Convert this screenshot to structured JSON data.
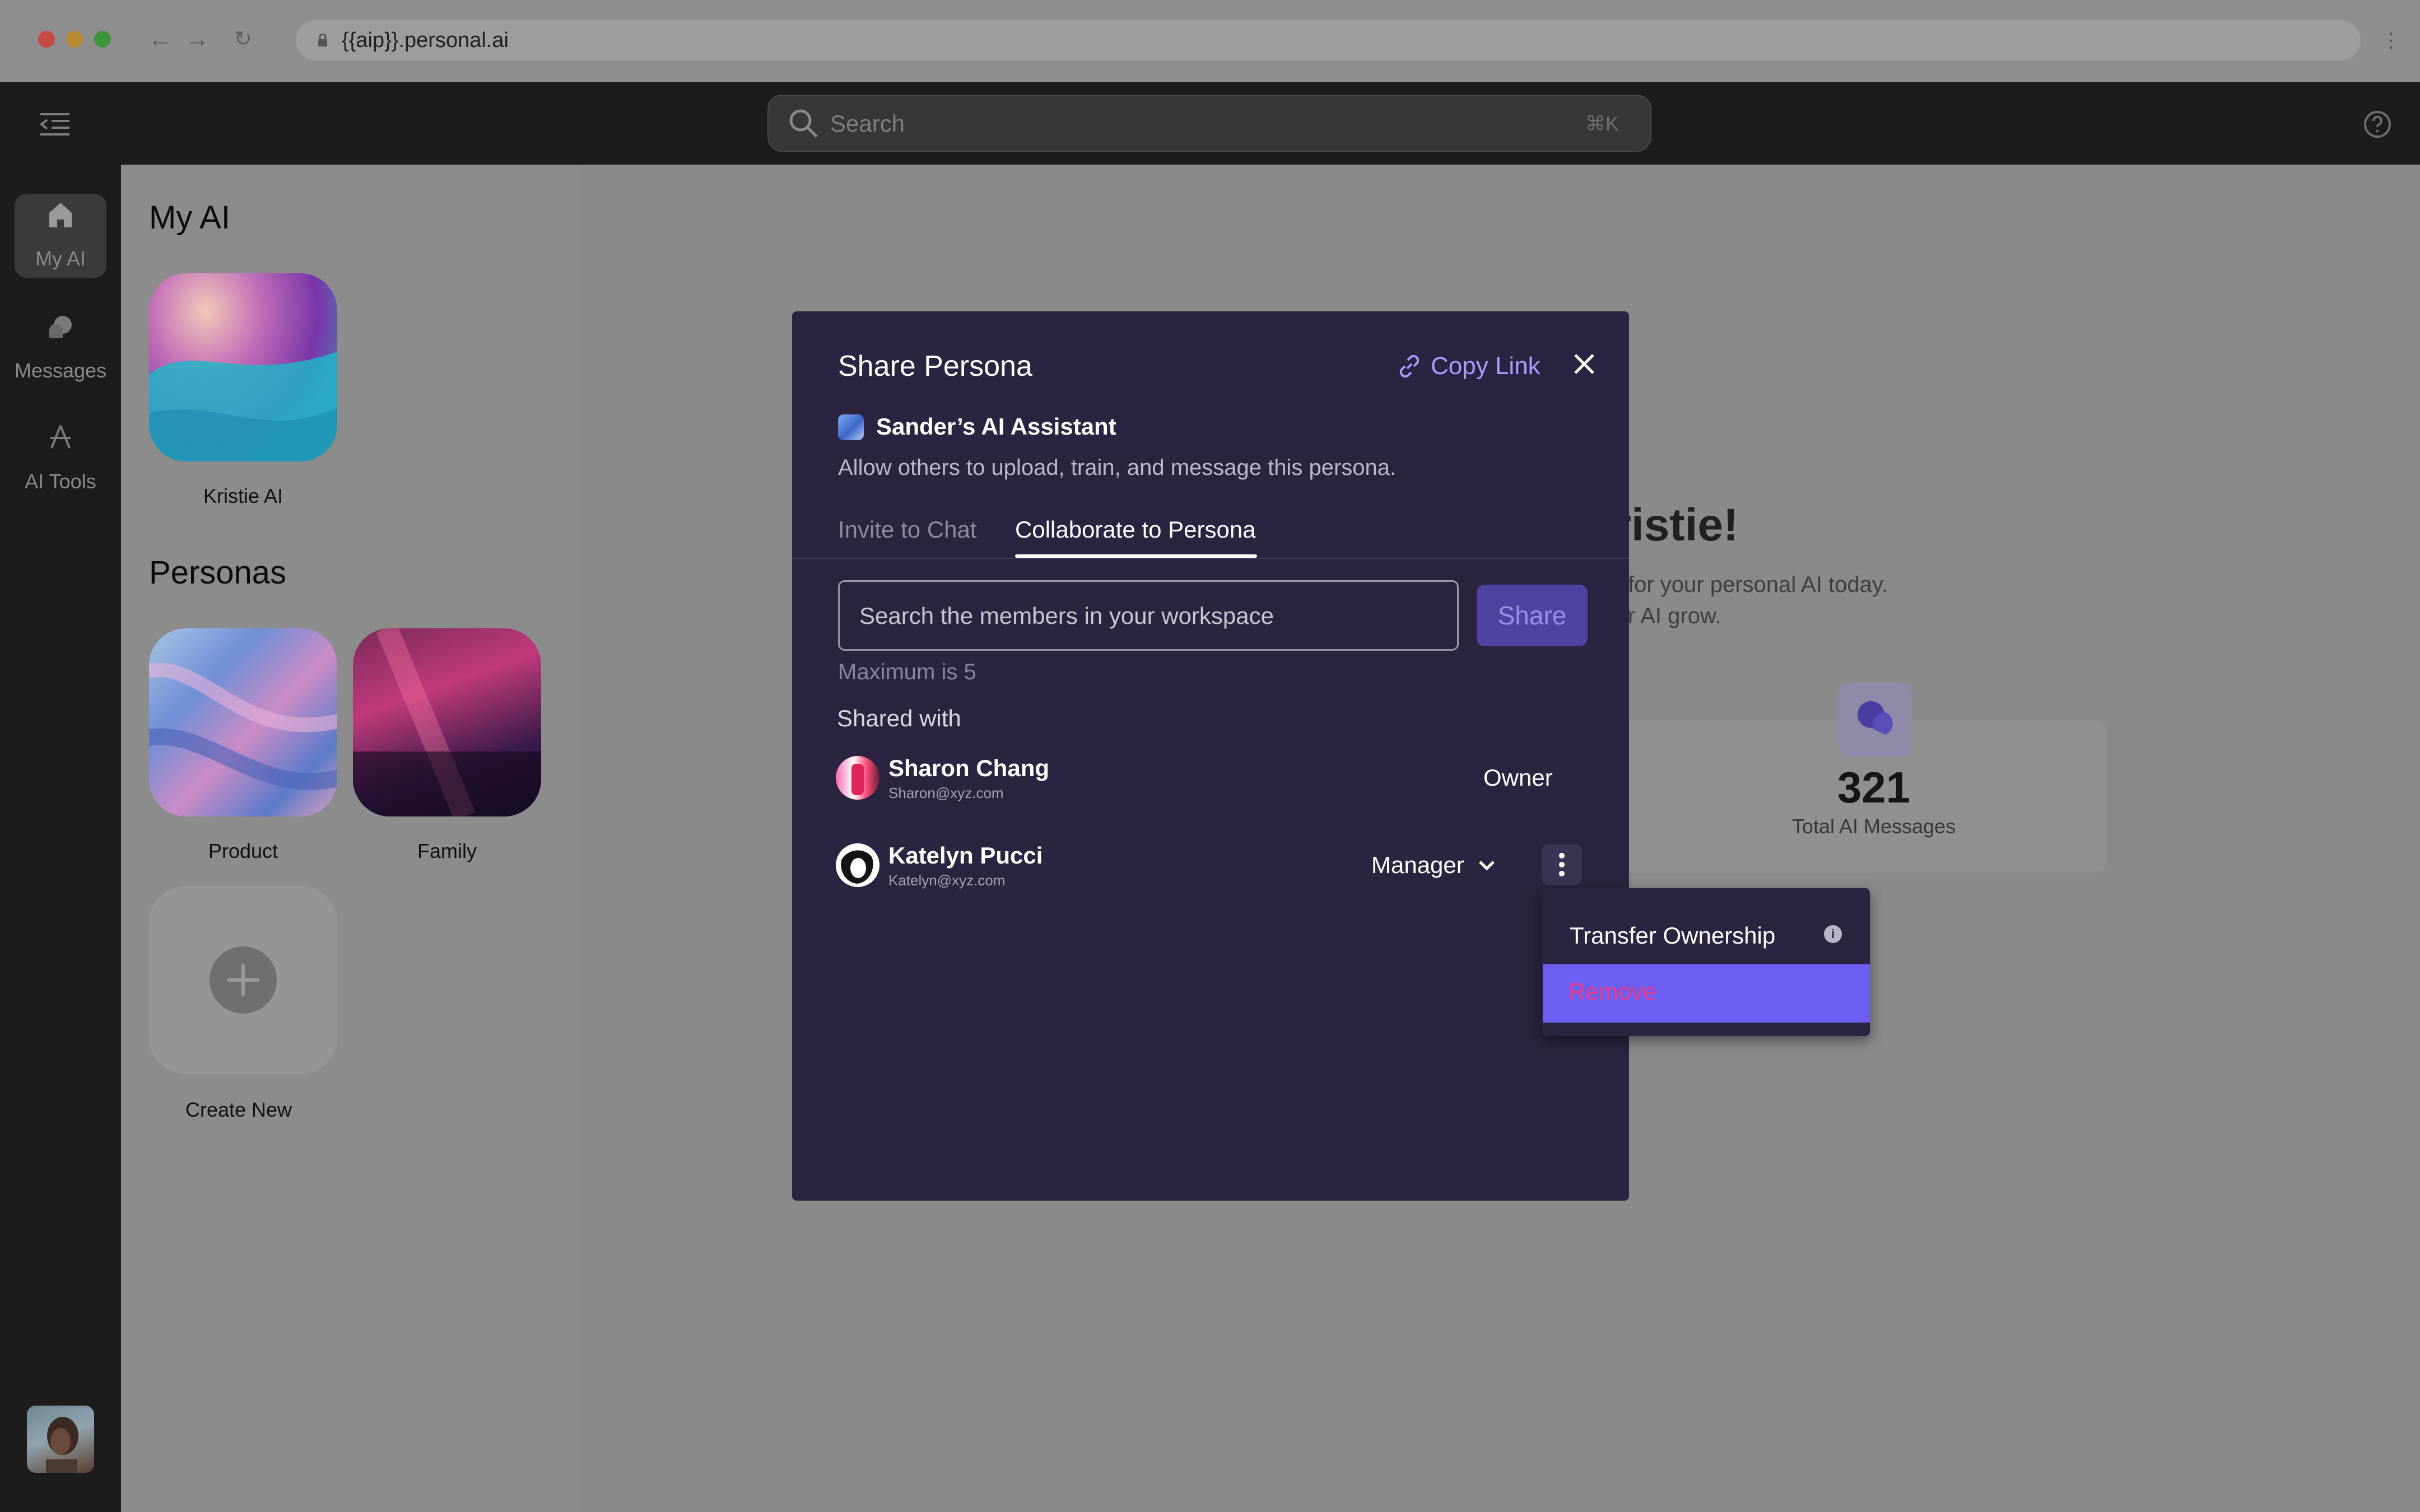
{
  "browser": {
    "url": "{{aip}}.personal.ai",
    "traffic_colors": [
      "#d0473f",
      "#c08d2e",
      "#3b9f3b"
    ]
  },
  "header": {
    "search_placeholder": "Search",
    "search_shortcut": "⌘K",
    "icons": [
      "sidebar-collapse-icon",
      "help-icon"
    ]
  },
  "nav": {
    "items": [
      {
        "label": "My AI",
        "icon": "home-icon",
        "active": true
      },
      {
        "label": "Messages",
        "icon": "messages-icon",
        "active": false
      },
      {
        "label": "AI Tools",
        "icon": "ai-tools-icon",
        "active": false
      }
    ]
  },
  "sidebar": {
    "my_ai_title": "My AI",
    "my_ai_item": "Kristie AI",
    "personas_title": "Personas",
    "personas": [
      "Product",
      "Family"
    ],
    "create_new": "Create New"
  },
  "background": {
    "greeting_fragment": "ristie!",
    "sub_line_1": "for your personal AI today.",
    "sub_line_2": "r AI grow.",
    "stat_value": "321",
    "stat_label": "Total AI Messages"
  },
  "modal": {
    "title": "Share Persona",
    "copy_link": "Copy Link",
    "persona_name": "Sander’s AI Assistant",
    "persona_description": "Allow others to upload, train, and message this persona.",
    "tabs": [
      {
        "label": "Invite to Chat",
        "active": false
      },
      {
        "label": "Collaborate to Persona",
        "active": true
      }
    ],
    "input_placeholder": "Search the members in your workspace",
    "share_button": "Share",
    "max_note": "Maximum is 5",
    "shared_with_label": "Shared with",
    "members": [
      {
        "name": "Sharon Chang",
        "email": "Sharon@xyz.com",
        "role": "Owner"
      },
      {
        "name": "Katelyn Pucci",
        "email": "Katelyn@xyz.com",
        "role": "Manager"
      }
    ]
  },
  "menu": {
    "items": [
      {
        "label": "Transfer Ownership",
        "icon": "info-icon"
      },
      {
        "label": "Remove",
        "highlighted": true
      }
    ]
  },
  "colors": {
    "modal_bg": "#2b2440",
    "accent": "#6c5ef0",
    "link": "#a89cff",
    "danger": "#ea3a8e"
  }
}
